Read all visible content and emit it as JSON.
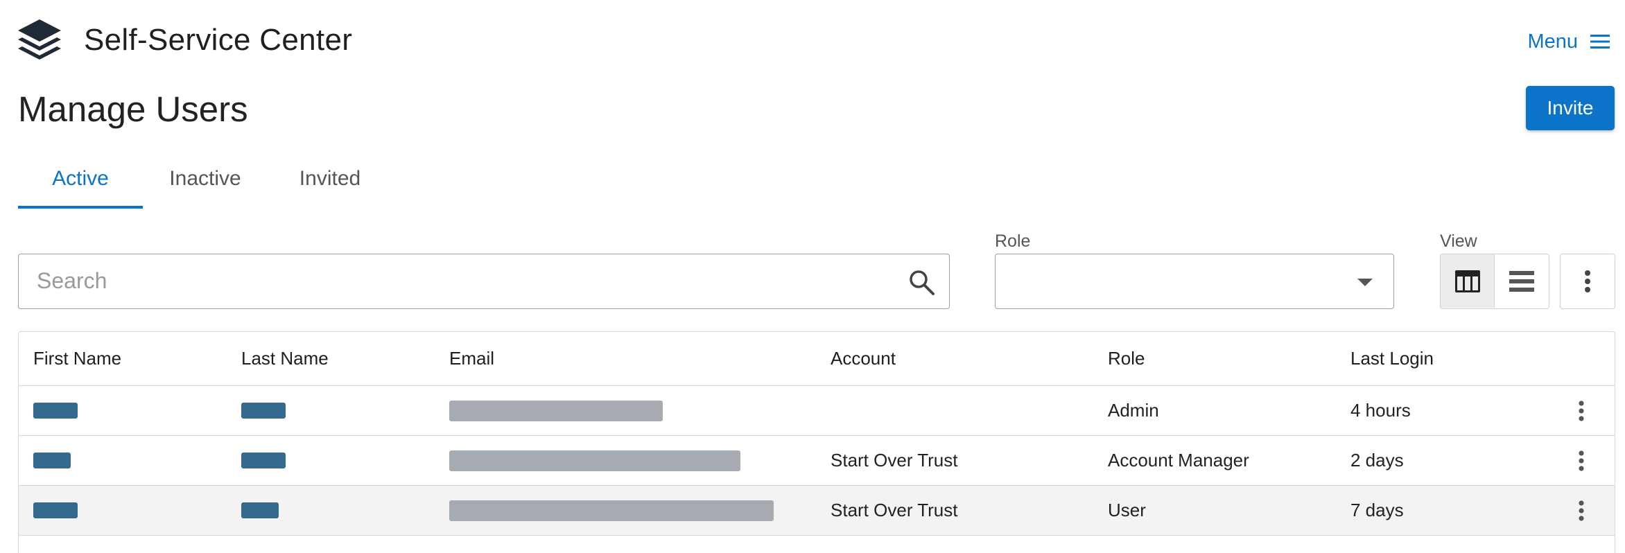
{
  "header": {
    "app_title": "Self-Service Center",
    "menu_label": "Menu",
    "logo_icon": "stacked-layers-icon",
    "menu_icon": "hamburger-icon"
  },
  "page": {
    "title": "Manage Users",
    "invite_label": "Invite"
  },
  "tabs": [
    {
      "label": "Active",
      "selected": true
    },
    {
      "label": "Inactive",
      "selected": false
    },
    {
      "label": "Invited",
      "selected": false
    }
  ],
  "filters": {
    "search_placeholder": "Search",
    "search_value": "",
    "role_label": "Role",
    "role_value": "",
    "view_label": "View",
    "view_selected": "table-view"
  },
  "table": {
    "columns": [
      "First Name",
      "Last Name",
      "Email",
      "Account",
      "Role",
      "Last Login"
    ],
    "rows": [
      {
        "first_name": "[redacted]",
        "last_name": "[redacted]",
        "email": "[redacted]",
        "account": "",
        "role": "Admin",
        "last_login": "4 hours"
      },
      {
        "first_name": "[redacted]",
        "last_name": "[redacted]",
        "email": "[redacted]",
        "account": "Start Over Trust",
        "role": "Account Manager",
        "last_login": "2 days"
      },
      {
        "first_name": "[redacted]",
        "last_name": "[redacted]",
        "email": "[redacted]",
        "account": "Start Over Trust",
        "role": "User",
        "last_login": "7 days"
      }
    ]
  },
  "colors": {
    "accent": "#0b74c8",
    "redacted_name": "#336a8d",
    "redacted_email": "#a5abb0",
    "hover_row": "#f3f3f3"
  }
}
